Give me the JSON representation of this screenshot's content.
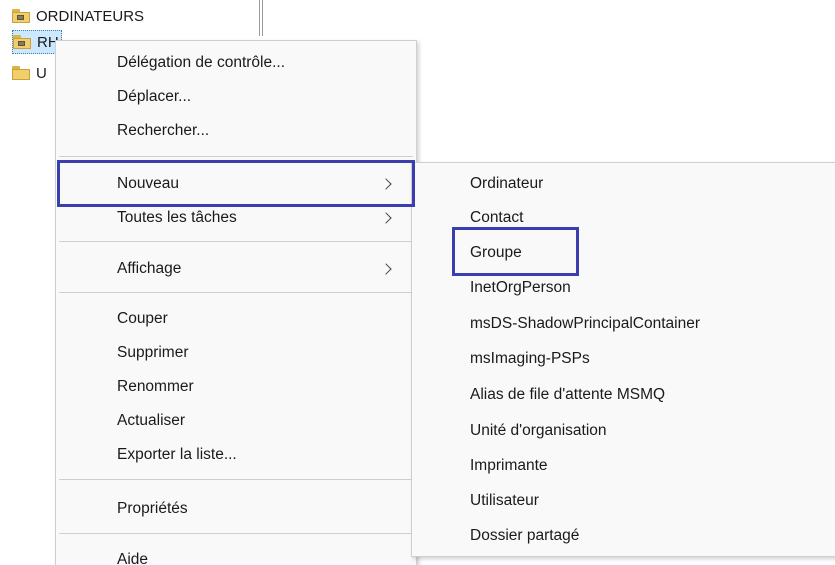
{
  "tree": {
    "items": [
      {
        "label": "ORDINATEURS"
      },
      {
        "label": "RH"
      },
      {
        "label": "U"
      }
    ]
  },
  "context_menu": {
    "items": [
      {
        "label": "Délégation de contrôle..."
      },
      {
        "label": "Déplacer..."
      },
      {
        "label": "Rechercher..."
      },
      {
        "label": "Nouveau"
      },
      {
        "label": "Toutes les tâches"
      },
      {
        "label": "Affichage"
      },
      {
        "label": "Couper"
      },
      {
        "label": "Supprimer"
      },
      {
        "label": "Renommer"
      },
      {
        "label": "Actualiser"
      },
      {
        "label": "Exporter la liste..."
      },
      {
        "label": "Propriétés"
      },
      {
        "label": "Aide"
      }
    ]
  },
  "submenu_nouveau": {
    "items": [
      {
        "label": "Ordinateur"
      },
      {
        "label": "Contact"
      },
      {
        "label": "Groupe"
      },
      {
        "label": "InetOrgPerson"
      },
      {
        "label": "msDS-ShadowPrincipalContainer"
      },
      {
        "label": "msImaging-PSPs"
      },
      {
        "label": "Alias de file d'attente MSMQ"
      },
      {
        "label": "Unité d'organisation"
      },
      {
        "label": "Imprimante"
      },
      {
        "label": "Utilisateur"
      },
      {
        "label": "Dossier partagé"
      }
    ]
  },
  "colors": {
    "highlight_border": "#3b3fae",
    "menu_background": "#f9f9f9",
    "selection_background": "#cce8ff"
  }
}
